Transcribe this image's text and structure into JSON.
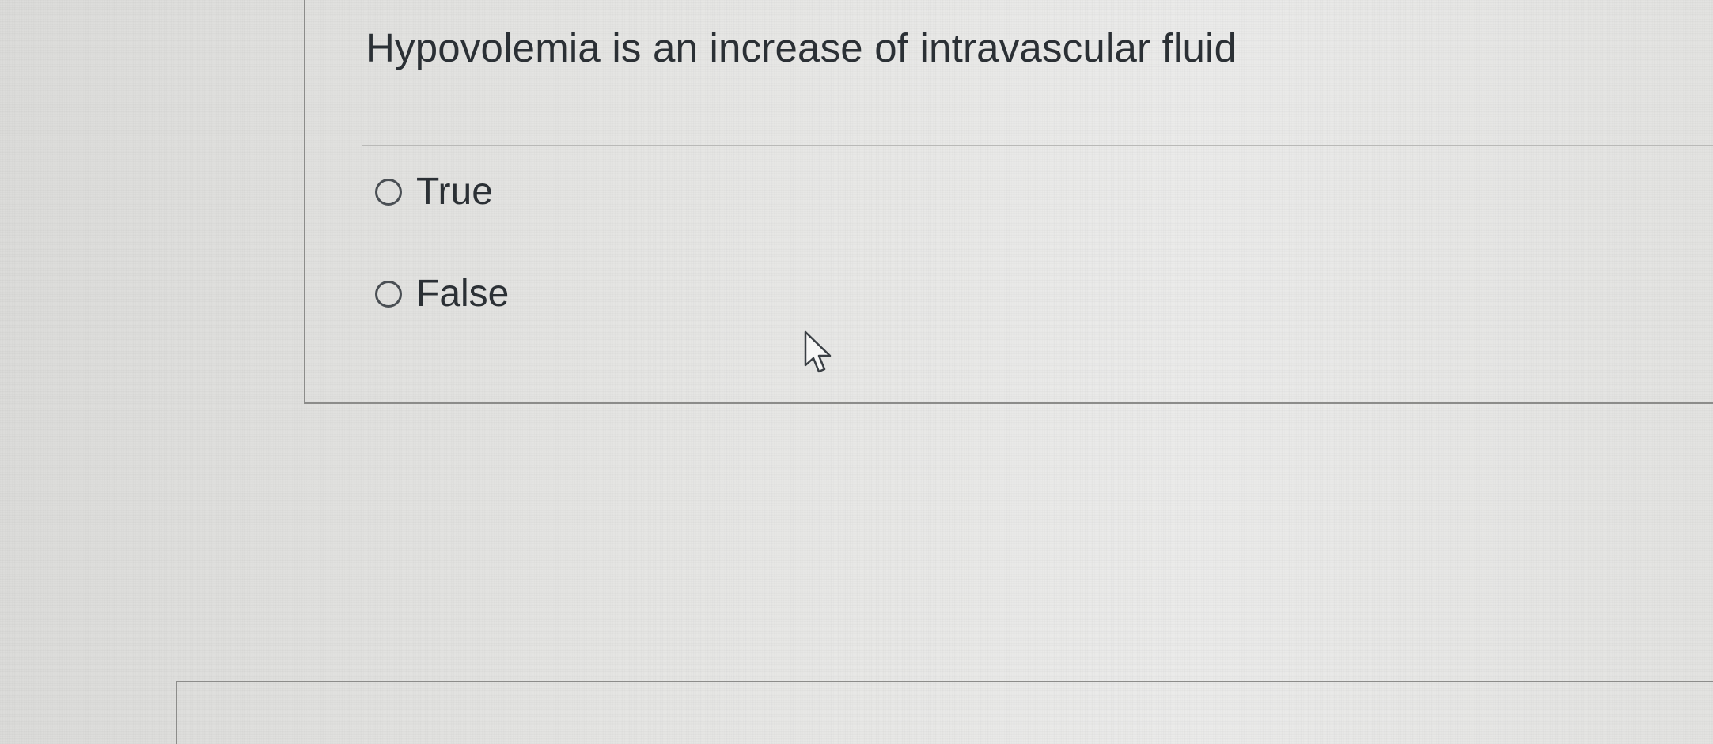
{
  "question": {
    "text": "Hypovolemia is an increase of intravascular fluid"
  },
  "answers": [
    {
      "label": "True",
      "selected": false
    },
    {
      "label": "False",
      "selected": false
    }
  ],
  "cursor": {
    "icon": "arrow-pointer-icon"
  },
  "colors": {
    "text": "#2b3035",
    "border": "#8c8c8a",
    "divider": "#b9b9b7",
    "background": "#e4e4e2"
  }
}
